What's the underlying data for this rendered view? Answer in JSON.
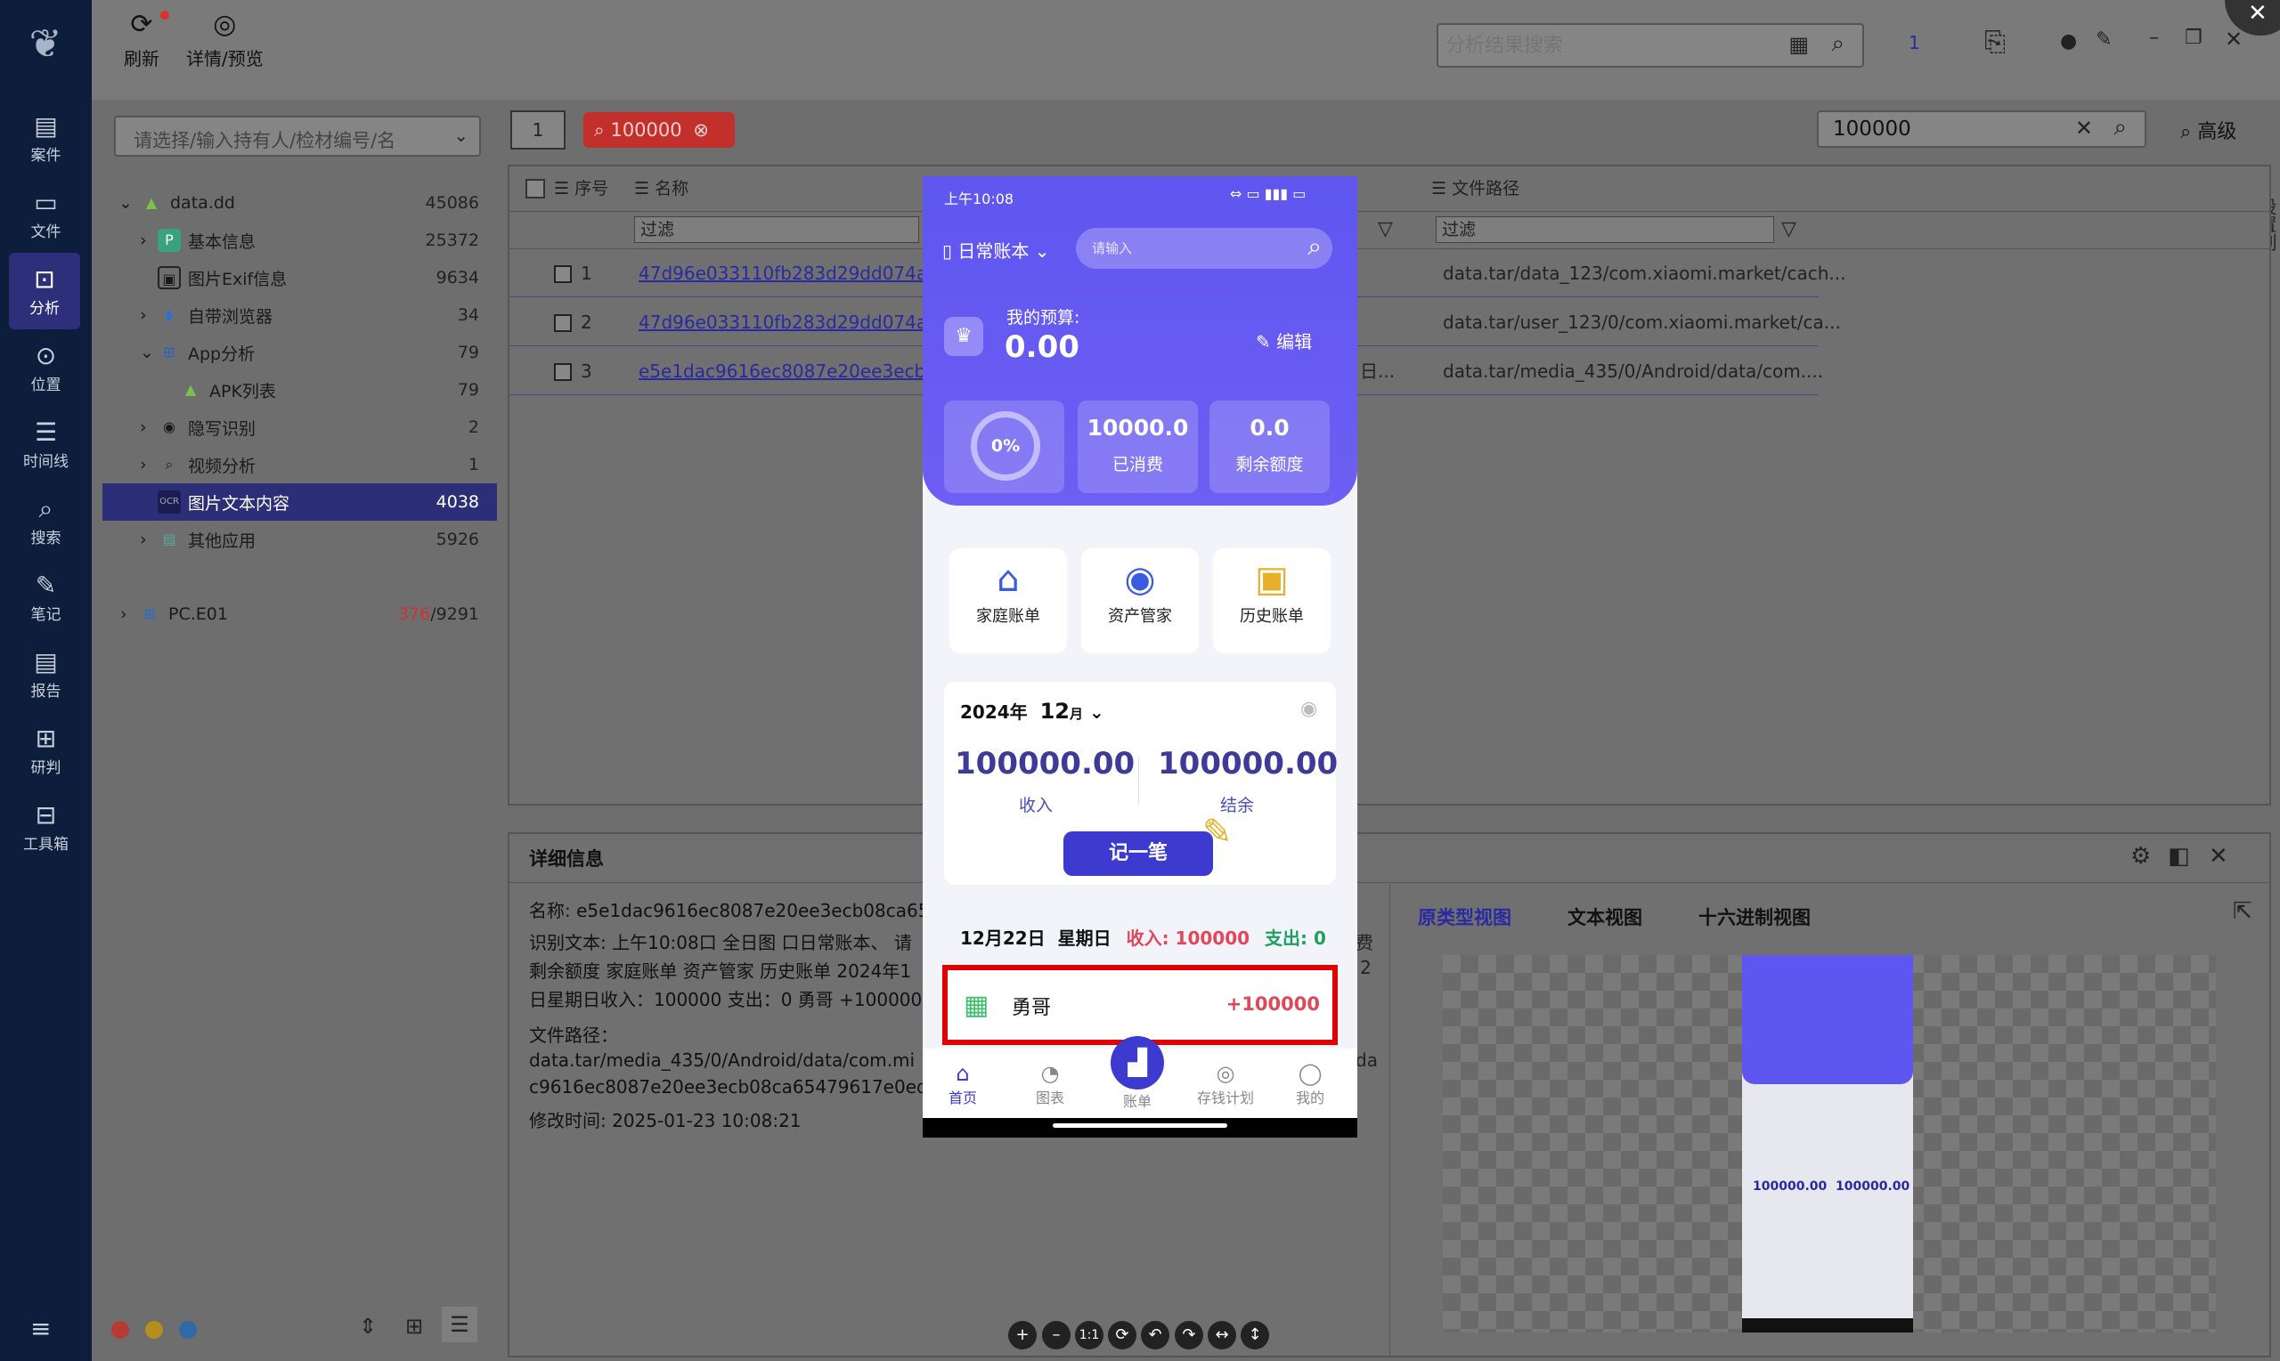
{
  "sidebar": {
    "items": [
      {
        "label": "案件"
      },
      {
        "label": "文件"
      },
      {
        "label": "分析"
      },
      {
        "label": "位置"
      },
      {
        "label": "时间线"
      },
      {
        "label": "搜索"
      },
      {
        "label": "笔记"
      },
      {
        "label": "报告"
      },
      {
        "label": "研判"
      },
      {
        "label": "工具箱"
      }
    ],
    "active_index": 2
  },
  "toolbar": {
    "refresh": "刷新",
    "detail_preview": "详情/预览",
    "search_placeholder": "分析结果搜索",
    "counter": "1"
  },
  "tree": {
    "filter_placeholder": "请选择/输入持有人/检材编号/名",
    "nodes": [
      {
        "label": "data.dd",
        "count": "45086"
      },
      {
        "label": "基本信息",
        "count": "25372"
      },
      {
        "label": "图片Exif信息",
        "count": "9634"
      },
      {
        "label": "自带浏览器",
        "count": "34"
      },
      {
        "label": "App分析",
        "count": "79"
      },
      {
        "label": "APK列表",
        "count": "79"
      },
      {
        "label": "隐写识别",
        "count": "2"
      },
      {
        "label": "视频分析",
        "count": "1"
      },
      {
        "label": "图片文本内容",
        "count": "4038"
      },
      {
        "label": "其他应用",
        "count": "5926"
      },
      {
        "label": "PC.E01",
        "count_red": "376",
        "count": "/9291"
      }
    ]
  },
  "tabs": {
    "search_chip": "100000",
    "right_search": "100000",
    "advanced": "高级",
    "settings_col": "设置列"
  },
  "table": {
    "headers": {
      "seq": "序号",
      "name": "名称",
      "path": "文件路径"
    },
    "filter": "过滤",
    "rows": [
      {
        "no": "1",
        "name": "47d96e033110fb283d29dd074a3b",
        "path": "data.tar/data_123/com.xiaomi.market/cach..."
      },
      {
        "no": "2",
        "name": "47d96e033110fb283d29dd074a3b",
        "path": "data.tar/user_123/0/com.xiaomi.market/ca..."
      },
      {
        "no": "3",
        "name": "e5e1dac9616ec8087e20ee3ecb08c",
        "path": "data.tar/media_435/0/Android/data/com....",
        "extra": "日..."
      }
    ]
  },
  "detail": {
    "title": "详细信息",
    "name_label": "名称:",
    "name_value": "e5e1dac9616ec8087e20ee3ecb08ca65",
    "ocr_label": "识别文本:",
    "ocr_line1": "上午10:08口 全日图 口日常账本、 请",
    "ocr_line2": "剩余额度 家庭账单 资产管家 历史账单 2024年1",
    "ocr_line3": "日星期日收入：100000 支出：0 勇哥 +100000",
    "ocr_tail1": "费",
    "ocr_tail2": "2",
    "path_label": "文件路径：",
    "path_line1": "data.tar/media_435/0/Android/data/com.mi",
    "path_line2": "c9616ec8087e20ee3ecb08ca65479617e0eda",
    "path_tail": "da",
    "mtime_label": "修改时间:",
    "mtime_value": "2025-01-23 10:08:21",
    "views": {
      "v1": "原类型视图",
      "v2": "文本视图",
      "v3": "十六进制视图"
    }
  },
  "phone": {
    "time": "上午10:08",
    "book": "日常账本",
    "search_placeholder": "请输入",
    "budget_label": "我的预算:",
    "budget_value": "0.00",
    "edit": "编辑",
    "percent": "0%",
    "consumed_value": "10000.0",
    "consumed_label": "已消费",
    "remain_value": "0.0",
    "remain_label": "剩余额度",
    "tiles": [
      "家庭账单",
      "资产管家",
      "历史账单"
    ],
    "year": "2024年",
    "month": "12",
    "month_suffix": "月",
    "income_value": "100000.00",
    "income_label": "收入",
    "balance_value": "100000.00",
    "balance_label": "结余",
    "record_btn": "记一笔",
    "day_date": "12月22日",
    "day_week": "星期日",
    "day_income": "收入: 100000",
    "day_expense": "支出: 0",
    "entry_name": "勇哥",
    "entry_amount": "+100000",
    "nav": [
      "首页",
      "图表",
      "账单",
      "存钱计划",
      "我的"
    ]
  },
  "colors": {
    "sidebar": "#0c1e3b",
    "accent": "#2c2f78",
    "phone_purple": "#6259f2",
    "highlight": "#e00000"
  }
}
